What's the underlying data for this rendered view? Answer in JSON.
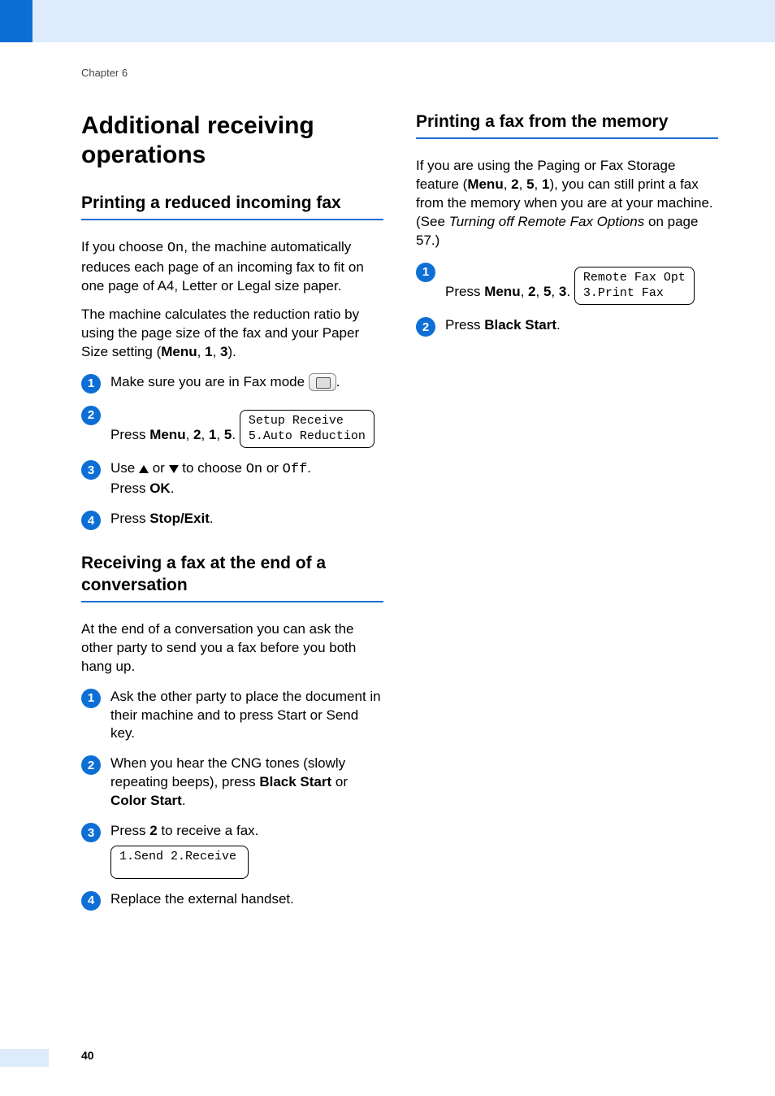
{
  "chapter": "Chapter 6",
  "page_number": "40",
  "left": {
    "title": "Additional receiving operations",
    "section1": {
      "heading": "Printing a reduced incoming fax",
      "p1_pre": "If you choose ",
      "p1_code": "On",
      "p1_post": ", the machine automatically reduces each page of an incoming fax to fit on one page of A4, Letter or Legal size paper.",
      "p2_a": "The machine calculates the reduction ratio by using the page size of the fax and your Paper Size setting (",
      "p2_b": "Menu",
      "p2_c": ", ",
      "p2_d": "1",
      "p2_e": ", ",
      "p2_f": "3",
      "p2_g": ").",
      "step1": "Make sure you are in Fax mode ",
      "step1_tail": ".",
      "step2_a": "Press ",
      "step2_b": "Menu",
      "step2_c": ", ",
      "step2_d": "2",
      "step2_e": ", ",
      "step2_f": "1",
      "step2_g": ", ",
      "step2_h": "5",
      "step2_i": ".",
      "lcd1_l1": "Setup Receive",
      "lcd1_l2": "5.Auto Reduction",
      "step3_a": "Use ",
      "step3_b": " or ",
      "step3_c": " to choose ",
      "step3_on": "On",
      "step3_d": " or ",
      "step3_off": "Off",
      "step3_e": ".",
      "step3_l2a": "Press ",
      "step3_l2b": "OK",
      "step3_l2c": ".",
      "step4_a": "Press ",
      "step4_b": "Stop/Exit",
      "step4_c": "."
    },
    "section2": {
      "heading": "Receiving a fax at the end of a conversation",
      "p1": "At the end of a conversation you can ask the other party to send you a fax before you both hang up.",
      "step1": "Ask the other party to place the document in their machine and to press Start or Send key.",
      "step2_a": "When you hear the CNG tones (slowly repeating beeps), press ",
      "step2_b": "Black Start",
      "step2_c": " or ",
      "step2_d": "Color Start",
      "step2_e": ".",
      "step3_a": "Press ",
      "step3_b": "2",
      "step3_c": " to receive a fax.",
      "lcd_l1": "1.Send 2.Receive",
      "step4": "Replace the external handset."
    }
  },
  "right": {
    "heading": "Printing a fax from the memory",
    "p1_a": "If you are using the Paging or Fax Storage feature (",
    "p1_b": "Menu",
    "p1_c": ", ",
    "p1_d": "2",
    "p1_e": ", ",
    "p1_f": "5",
    "p1_g": ", ",
    "p1_h": "1",
    "p1_i": "), you can still print a fax from the memory when you are at your machine. (See ",
    "p1_ref": "Turning off Remote Fax Options",
    "p1_j": " on page 57.)",
    "step1_a": "Press ",
    "step1_b": "Menu",
    "step1_c": ", ",
    "step1_d": "2",
    "step1_e": ", ",
    "step1_f": "5",
    "step1_g": ", ",
    "step1_h": "3",
    "step1_i": ".",
    "lcd_l1": "Remote Fax Opt",
    "lcd_l2": "3.Print Fax",
    "step2_a": "Press ",
    "step2_b": "Black Start",
    "step2_c": "."
  }
}
